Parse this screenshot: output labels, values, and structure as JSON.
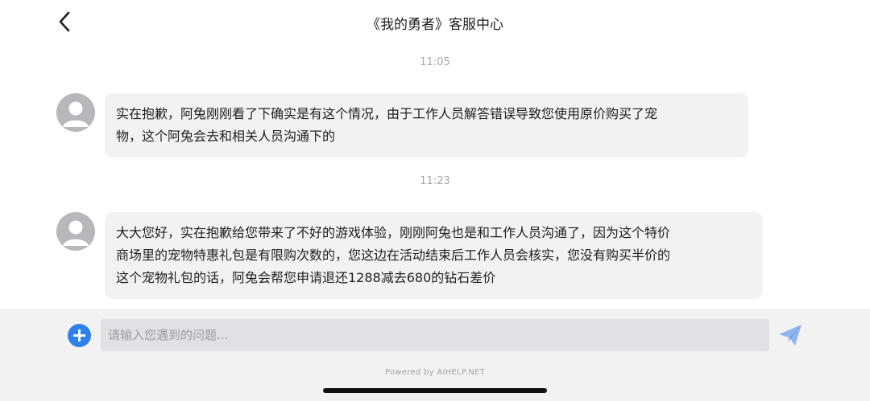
{
  "header": {
    "back_icon": "chevron-left-icon",
    "title": "《我的勇者》客服中心"
  },
  "messages": [
    {
      "time": "11:05",
      "sender_avatar": "avatar-placeholder",
      "lines": [
        "实在抱歉，阿兔刚刚看了下确实是有这个情况，由于工作人员解答错误导致您使用原价购买了宠",
        "物，这个阿兔会去和相关人员沟通下的"
      ]
    },
    {
      "time": "11:23",
      "sender_avatar": "avatar-placeholder",
      "lines": [
        "大大您好，实在抱歉给您带来了不好的游戏体验，刚刚阿兔也是和工作人员沟通了，因为这个特价",
        "商场里的宠物特惠礼包是有限购次数的，您这边在活动结束后工作人员会核实，您没有购买半价的",
        "这个宠物礼包的话，阿兔会帮您申请退还1288减去680的钻石差价"
      ]
    }
  ],
  "composer": {
    "add_icon": "plus-circle-icon",
    "placeholder": "请输入您遇到的问题...",
    "value": "",
    "send_icon": "send-icon",
    "accent_color": "#2f80ed",
    "send_color": "#8fb4ee"
  },
  "footer": {
    "powered_by": "Powered by AIHELP.NET"
  }
}
